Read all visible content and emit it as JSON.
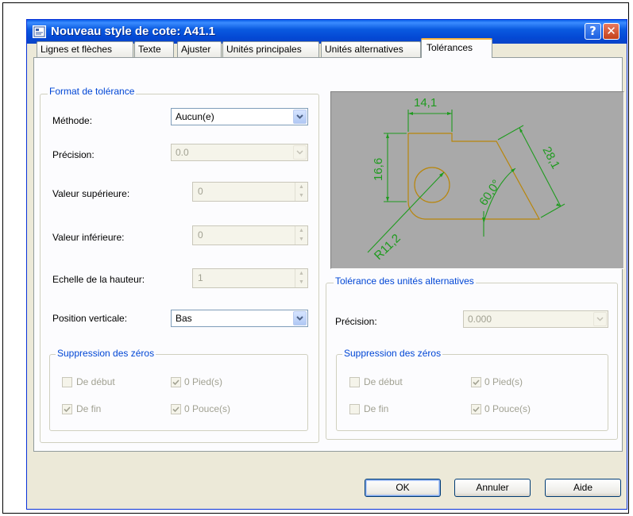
{
  "window": {
    "title": "Nouveau style de cote: A41.1",
    "help_glyph": "?",
    "close_glyph": "✕"
  },
  "tabs": [
    {
      "label": "Lignes et flèches",
      "active": false
    },
    {
      "label": "Texte",
      "active": false
    },
    {
      "label": "Ajuster",
      "active": false
    },
    {
      "label": "Unités principales",
      "active": false
    },
    {
      "label": "Unités alternatives",
      "active": false
    },
    {
      "label": "Tolérances",
      "active": true
    }
  ],
  "format_tolerance": {
    "group_label": "Format de tolérance",
    "methode_label": "Méthode:",
    "methode_value": "Aucun(e)",
    "precision_label": "Précision:",
    "precision_value": "0.0",
    "valeur_sup_label": "Valeur supérieure:",
    "valeur_sup_value": "0",
    "valeur_inf_label": "Valeur inférieure:",
    "valeur_inf_value": "0",
    "echelle_label": "Echelle de la hauteur:",
    "echelle_value": "1",
    "position_label": "Position verticale:",
    "position_value": "Bas",
    "zeros": {
      "group_label": "Suppression des zéros",
      "debut_label": "De début",
      "debut_checked": false,
      "fin_label": "De fin",
      "fin_checked": true,
      "pied_label": "0 Pied(s)",
      "pied_checked": true,
      "pouce_label": "0 Pouce(s)",
      "pouce_checked": true
    }
  },
  "preview": {
    "dim_top": "14,1",
    "dim_left": "16,6",
    "dim_right": "28,1",
    "dim_angle": "60,0°",
    "dim_radius": "R11,2"
  },
  "alt_tolerance": {
    "group_label": "Tolérance des unités alternatives",
    "precision_label": "Précision:",
    "precision_value": "0.000",
    "zeros": {
      "group_label": "Suppression des zéros",
      "debut_label": "De début",
      "debut_checked": false,
      "fin_label": "De fin",
      "fin_checked": false,
      "pied_label": "0 Pied(s)",
      "pied_checked": true,
      "pouce_label": "0 Pouce(s)",
      "pouce_checked": true
    }
  },
  "buttons": {
    "ok": "OK",
    "annuler": "Annuler",
    "aide": "Aide"
  },
  "colors": {
    "titlebar": "#0a5ae0",
    "group_label": "#0046d5",
    "preview_bg": "#a9a9a9",
    "preview_green": "#1f9b1f",
    "preview_orange": "#b8860b"
  }
}
